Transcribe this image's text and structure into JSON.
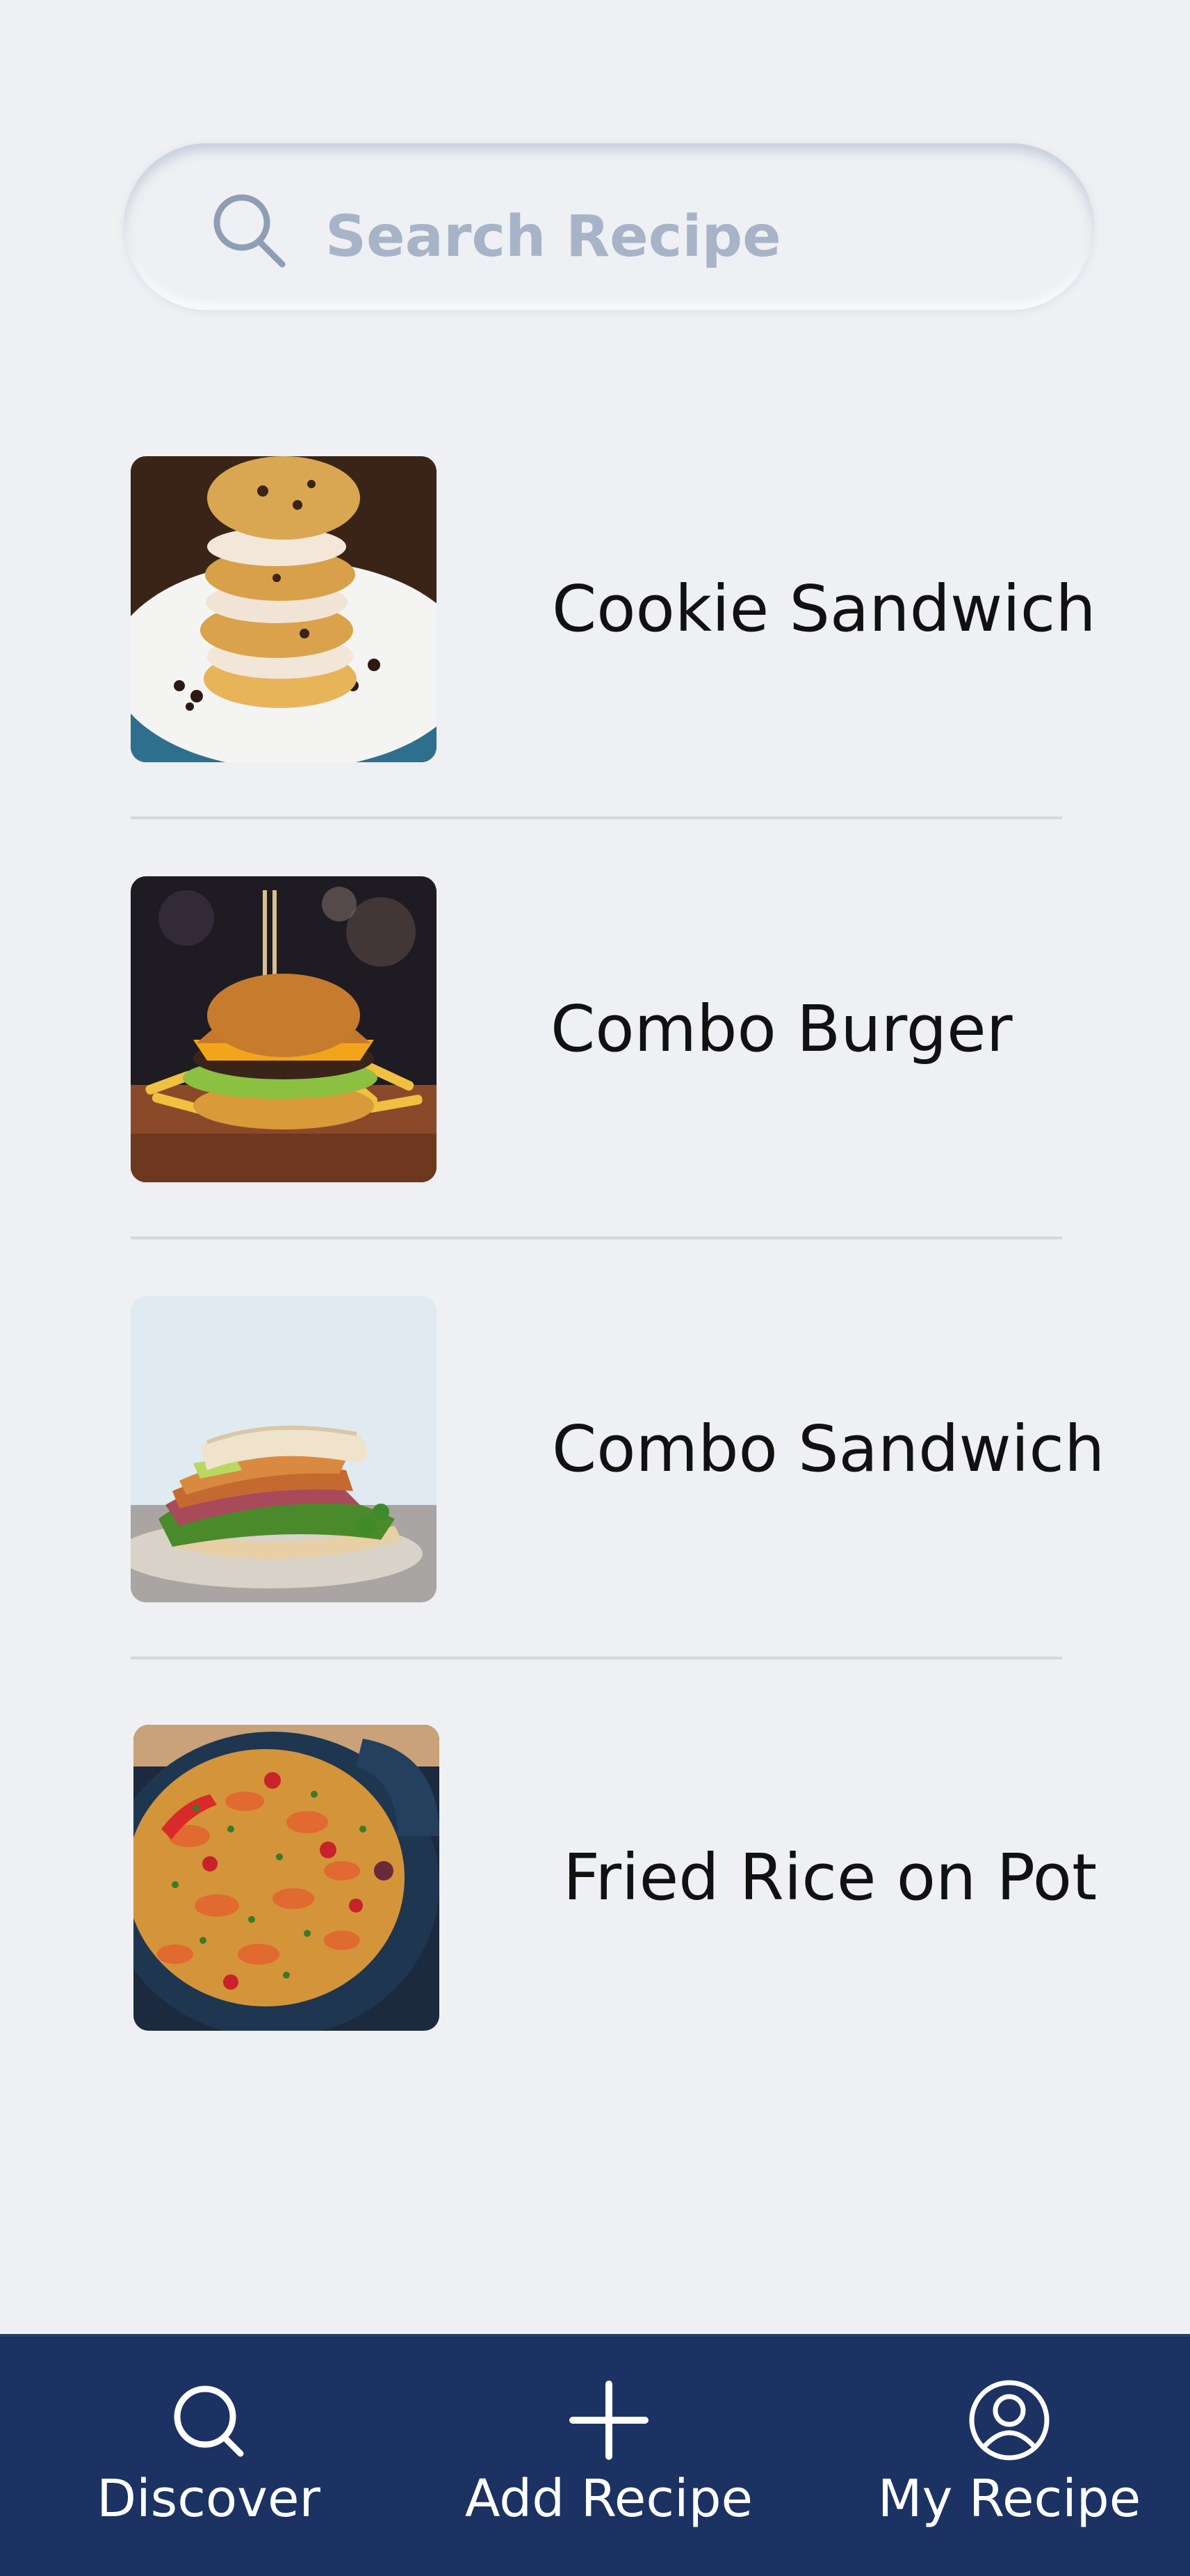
{
  "search": {
    "placeholder": "Search Recipe",
    "value": ""
  },
  "recipes": [
    {
      "title": "Cookie Sandwich",
      "image": "cookie-sandwich-photo"
    },
    {
      "title": "Combo Burger",
      "image": "combo-burger-photo"
    },
    {
      "title": "Combo Sandwich",
      "image": "combo-sandwich-photo"
    },
    {
      "title": "Fried Rice on Pot",
      "image": "fried-rice-pot-photo"
    }
  ],
  "nav": {
    "items": [
      {
        "label": "Discover",
        "icon": "search-icon"
      },
      {
        "label": "Add Recipe",
        "icon": "plus-icon"
      },
      {
        "label": "My Recipe",
        "icon": "user-circle-icon"
      }
    ]
  },
  "colors": {
    "background": "#eef0f3",
    "nav_background": "#1b3263",
    "search_text": "#a7b4c8",
    "divider": "#d4d7dc",
    "title_text": "#111111"
  }
}
